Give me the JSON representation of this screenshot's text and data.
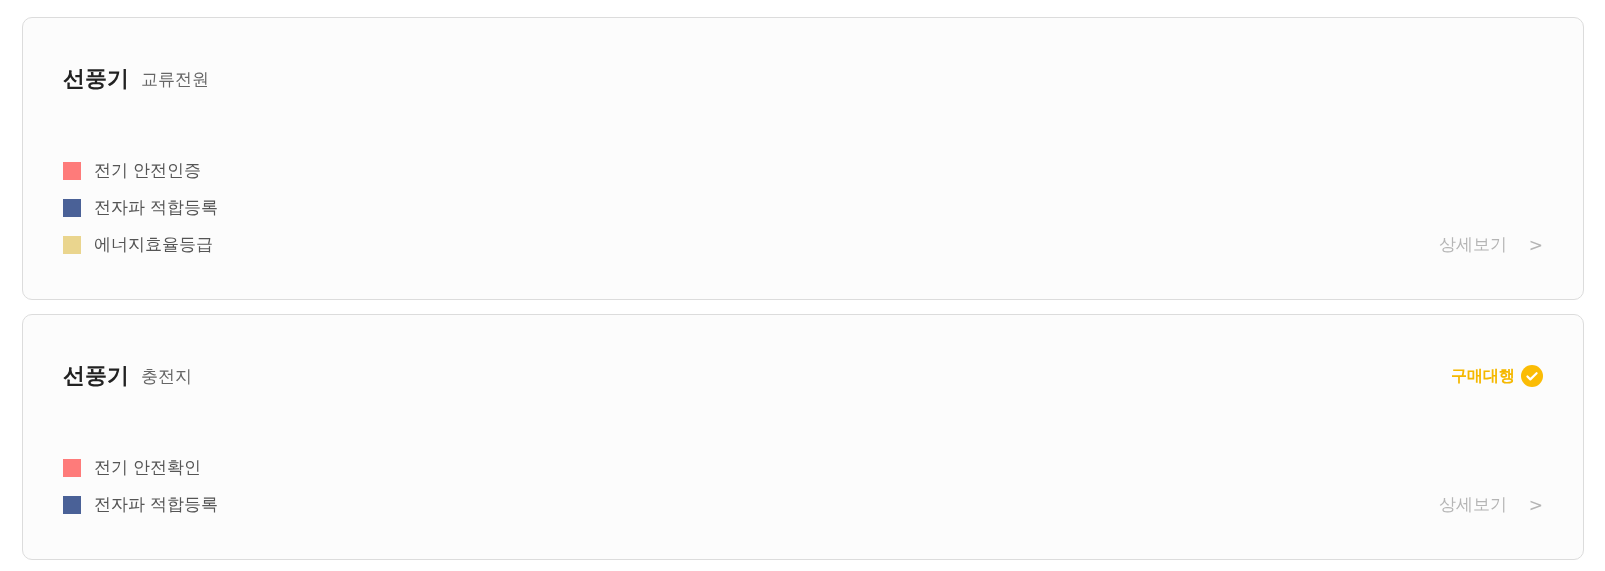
{
  "cards": [
    {
      "title": "선풍기",
      "subtitle": "교류전원",
      "certifications": [
        {
          "label": "전기 안전인증",
          "color": "#fe7b7a"
        },
        {
          "label": "전자파 적합등록",
          "color": "#4a6197"
        },
        {
          "label": "에너지효율등급",
          "color": "#ead58e"
        }
      ],
      "details_link": {
        "label": "상세보기",
        "arrow": ">"
      }
    },
    {
      "title": "선풍기",
      "subtitle": "충전지",
      "badge": {
        "label": "구매대행"
      },
      "certifications": [
        {
          "label": "전기 안전확인",
          "color": "#fe7b7a"
        },
        {
          "label": "전자파 적합등록",
          "color": "#4a6197"
        }
      ],
      "details_link": {
        "label": "상세보기",
        "arrow": ">"
      }
    }
  ]
}
